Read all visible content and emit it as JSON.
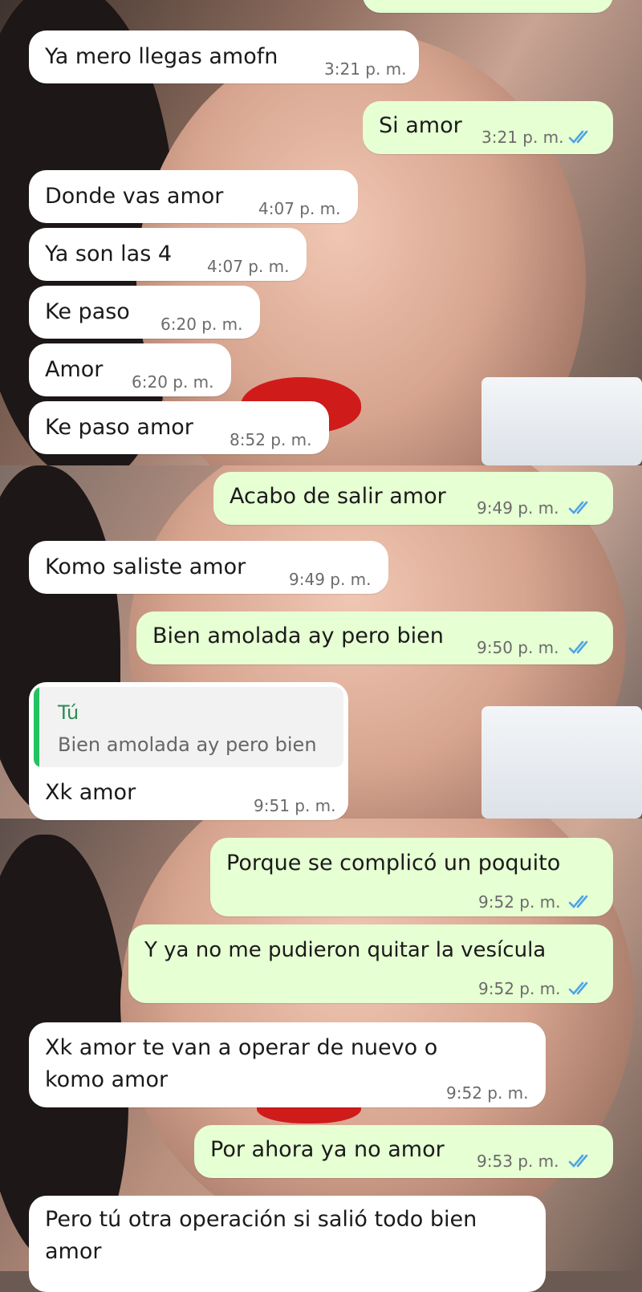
{
  "messages": [
    {
      "id": "m1",
      "dir": "in",
      "text": "Ya mero llegas amofn",
      "time": "3:21 p. m."
    },
    {
      "id": "m2",
      "dir": "out",
      "text": "Si amor",
      "time": "3:21 p. m."
    },
    {
      "id": "m3",
      "dir": "in",
      "text": "Donde vas amor",
      "time": "4:07 p. m."
    },
    {
      "id": "m4",
      "dir": "in",
      "text": "Ya son las 4",
      "time": "4:07 p. m."
    },
    {
      "id": "m5",
      "dir": "in",
      "text": "Ke paso",
      "time": "6:20 p. m."
    },
    {
      "id": "m6",
      "dir": "in",
      "text": "Amor",
      "time": "6:20 p. m."
    },
    {
      "id": "m7",
      "dir": "in",
      "text": "Ke paso amor",
      "time": "8:52 p. m."
    },
    {
      "id": "m8",
      "dir": "out",
      "text": "Acabo de salir amor",
      "time": "9:49 p. m."
    },
    {
      "id": "m9",
      "dir": "in",
      "text": "Komo saliste amor",
      "time": "9:49 p. m."
    },
    {
      "id": "m10",
      "dir": "out",
      "text": "Bien amolada ay pero bien",
      "time": "9:50 p. m."
    },
    {
      "id": "m11",
      "dir": "in",
      "text": "Xk amor",
      "time": "9:51 p. m.",
      "reply": {
        "author": "Tú",
        "text": "Bien amolada ay pero bien"
      }
    },
    {
      "id": "m12",
      "dir": "out",
      "text": "Porque se complicó un poquito",
      "time": "9:52 p. m."
    },
    {
      "id": "m13",
      "dir": "out",
      "text": "Y ya no me pudieron quitar la vesícula",
      "time": "9:52 p. m."
    },
    {
      "id": "m14",
      "dir": "in",
      "text": "Xk amor te van a operar de nuevo o komo amor",
      "time": "9:52 p. m."
    },
    {
      "id": "m15",
      "dir": "out",
      "text": "Por ahora ya no amor",
      "time": "9:53 p. m."
    },
    {
      "id": "m16",
      "dir": "in",
      "text": "Pero tú otra operación si salió todo bien amor",
      "time": ""
    }
  ],
  "colors": {
    "incoming": "#ffffff",
    "outgoing": "#e6ffd3",
    "read_ticks": "#4fa3e6",
    "reply_bar": "#25c262"
  },
  "icons": {
    "read_receipt": "double-check-icon"
  }
}
